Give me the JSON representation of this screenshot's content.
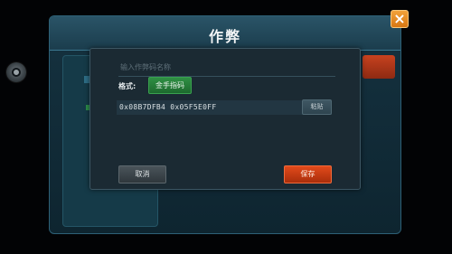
{
  "window": {
    "title": "作弊"
  },
  "icons": {
    "side": "camera-icon",
    "close": "close-icon"
  },
  "dialog": {
    "name_placeholder": "输入作弊码名称",
    "format_label": "格式:",
    "format_value": "金手指码",
    "code_value": "0x08B7DFB4 0x05F5E0FF",
    "paste_label": "粘贴",
    "cancel_label": "取消",
    "save_label": "保存"
  },
  "colors": {
    "accent_close": "#e8891f",
    "format_green": "#2a8a40",
    "save_orange": "#d2401a",
    "header_teal": "#24495a"
  }
}
